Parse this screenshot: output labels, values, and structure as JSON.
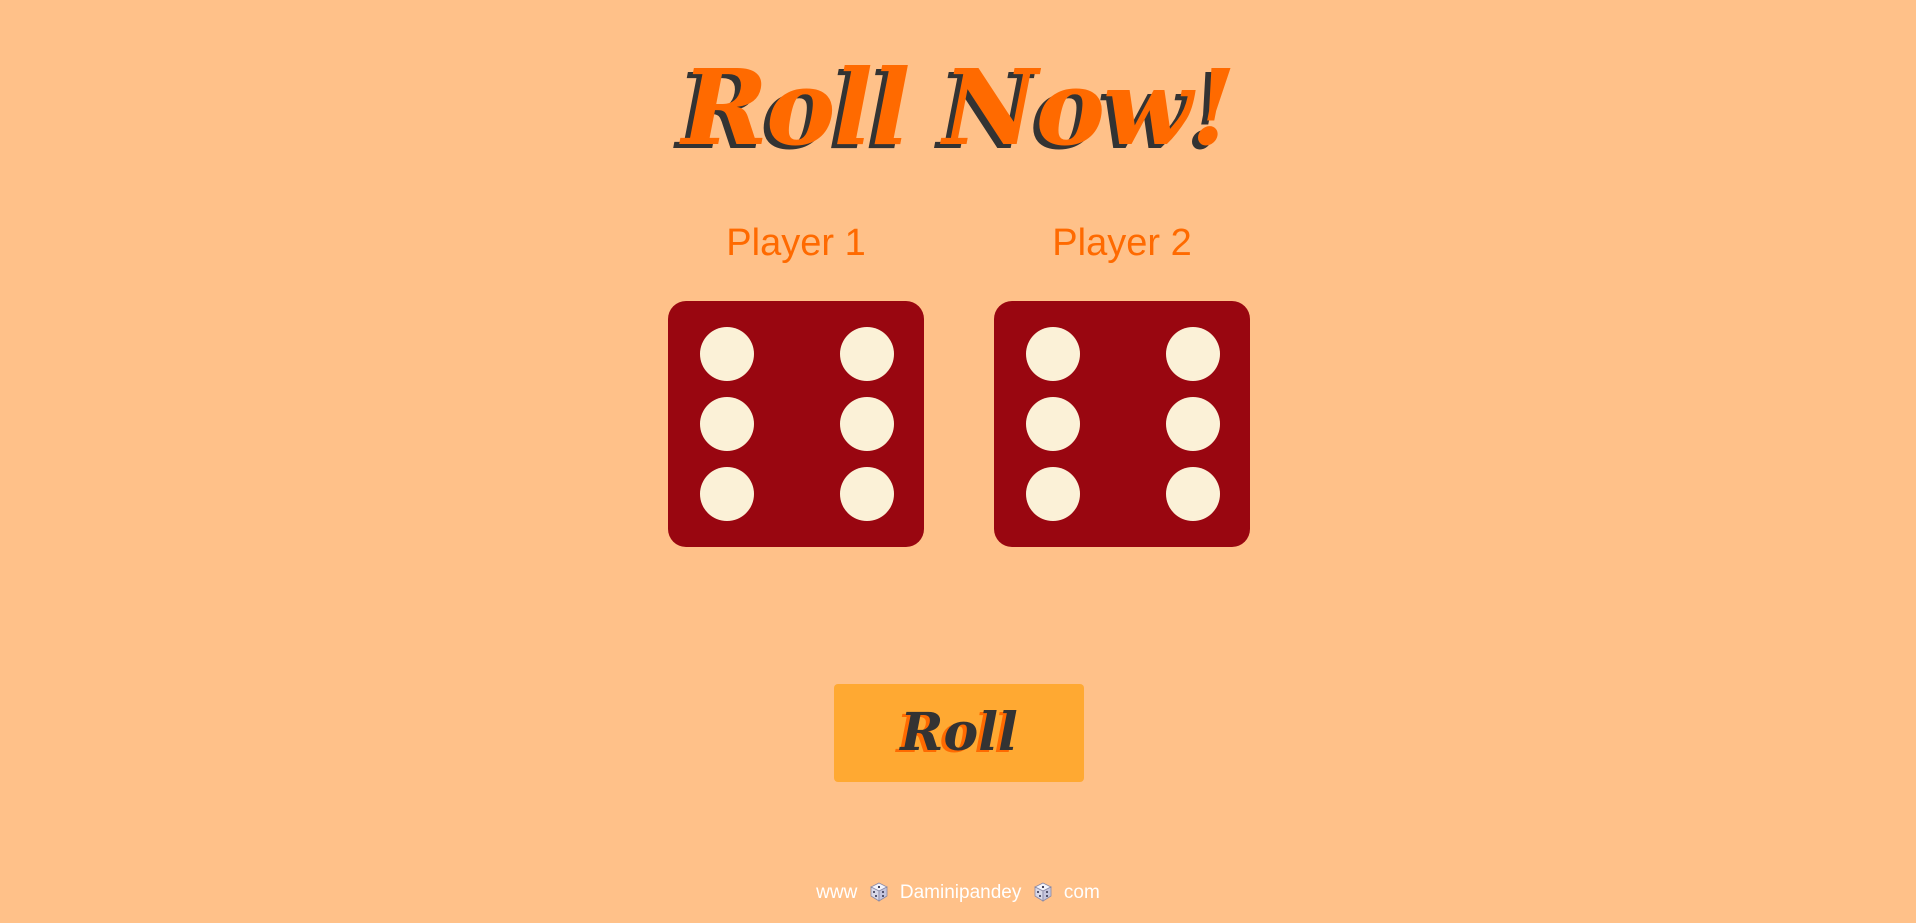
{
  "header": {
    "title": "Roll Now!"
  },
  "players": [
    {
      "label": "Player 1",
      "die_value": 6
    },
    {
      "label": "Player 2",
      "die_value": 6
    }
  ],
  "controls": {
    "roll_label": "Roll"
  },
  "footer": {
    "prefix": "www",
    "name": "Daminipandey",
    "suffix": "com",
    "separator_icon": "dice-icon"
  },
  "colors": {
    "background": "#ffc189",
    "title": "#ff6a00",
    "title_shadow": "#333333",
    "die_face": "#990610",
    "pip": "#fbf1d7",
    "button": "#ffa932",
    "footer_text": "#ffffff"
  }
}
